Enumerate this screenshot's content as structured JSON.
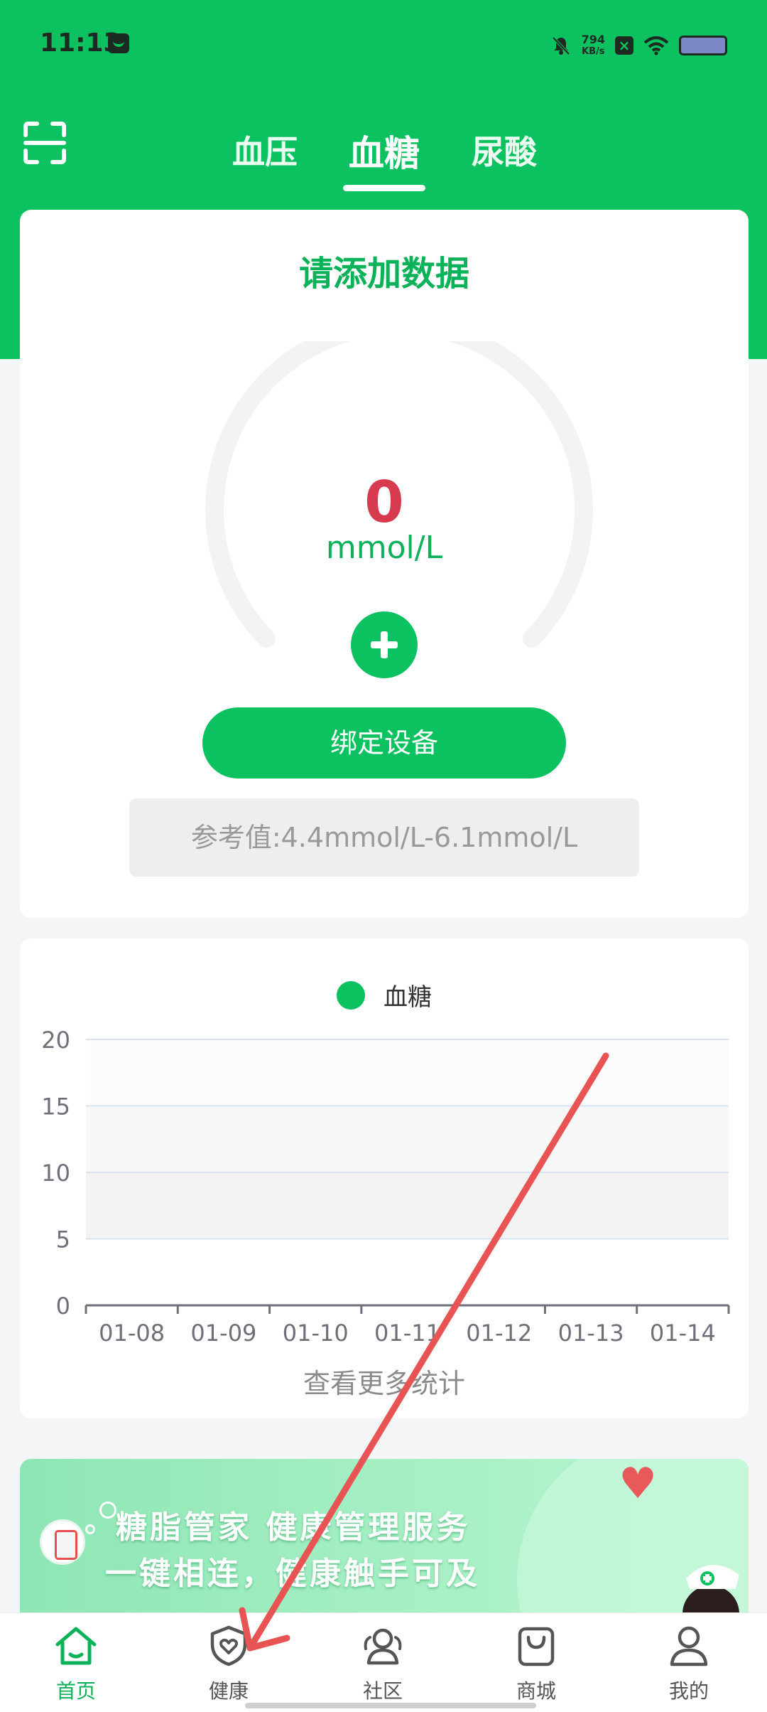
{
  "status_bar": {
    "time": "11:13",
    "net_speed_value": "794",
    "net_speed_unit": "KB/s",
    "icons": [
      "app-notification-icon",
      "mute-icon",
      "x-app-icon",
      "wifi-icon",
      "battery-icon"
    ]
  },
  "header": {
    "scan_icon": "scan-icon",
    "tabs": [
      {
        "label": "血压",
        "active": false
      },
      {
        "label": "血糖",
        "active": true
      },
      {
        "label": "尿酸",
        "active": false
      }
    ]
  },
  "measure_card": {
    "title": "请添加数据",
    "value": "0",
    "unit": "mmol/L",
    "add_icon": "plus-icon",
    "bind_button": "绑定设备",
    "reference": "参考值:4.4mmol/L-6.1mmol/L"
  },
  "chart_card": {
    "more_link": "查看更多统计"
  },
  "chart_data": {
    "type": "line",
    "series": [
      {
        "name": "血糖",
        "values": [
          null,
          null,
          null,
          null,
          null,
          null,
          null
        ]
      }
    ],
    "categories": [
      "01-08",
      "01-09",
      "01-10",
      "01-11",
      "01-12",
      "01-13",
      "01-14"
    ],
    "yticks": [
      "0",
      "5",
      "10",
      "15",
      "20"
    ],
    "ylim": [
      0,
      20
    ],
    "grid": true,
    "legend_position": "top-center",
    "colors": {
      "series": "#0cc160",
      "grid": "#dbe2ef",
      "axis": "#6e7079"
    }
  },
  "banner": {
    "line1": "糖脂管家 健康管理服务",
    "line2": "一键相连，健康触手可及"
  },
  "bottom_nav": [
    {
      "label": "首页",
      "icon": "home-icon",
      "active": true
    },
    {
      "label": "健康",
      "icon": "health-shield-icon",
      "active": false
    },
    {
      "label": "社区",
      "icon": "community-icon",
      "active": false
    },
    {
      "label": "商城",
      "icon": "shopping-bag-icon",
      "active": false
    },
    {
      "label": "我的",
      "icon": "profile-icon",
      "active": false
    }
  ],
  "colors": {
    "brand_green": "#0cc160",
    "value_red": "#d63a4e",
    "annotation_arrow": "#e85454"
  }
}
